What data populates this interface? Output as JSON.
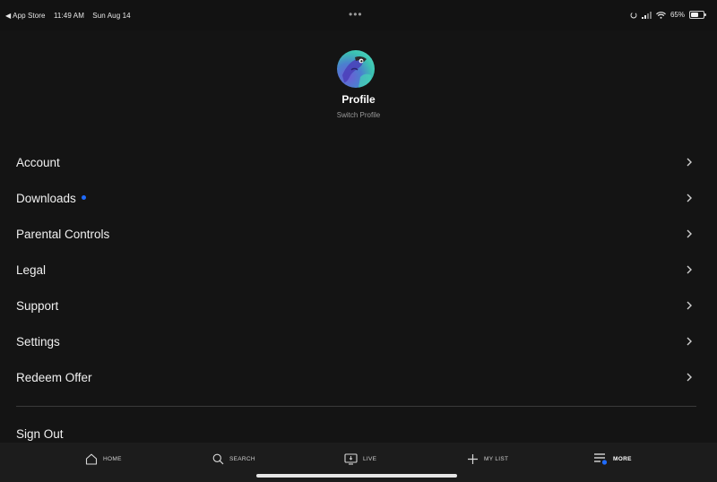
{
  "status_bar": {
    "back_app": "◀ App Store",
    "time": "11:49 AM",
    "date": "Sun Aug 14",
    "dots": "•••",
    "battery_percent": "65%",
    "battery_level": 0.65
  },
  "profile": {
    "name": "Profile",
    "switch_label": "Switch Profile"
  },
  "menu": {
    "items": [
      {
        "label": "Account"
      },
      {
        "label": "Downloads",
        "has_badge": true
      },
      {
        "label": "Parental Controls"
      },
      {
        "label": "Legal"
      },
      {
        "label": "Support"
      },
      {
        "label": "Settings"
      },
      {
        "label": "Redeem Offer"
      }
    ],
    "sign_out": "Sign Out"
  },
  "tab_bar": {
    "tabs": [
      {
        "label": "HOME",
        "icon": "home-icon"
      },
      {
        "label": "SEARCH",
        "icon": "search-icon"
      },
      {
        "label": "LIVE",
        "icon": "live-tv-icon"
      },
      {
        "label": "MY LIST",
        "icon": "plus-icon"
      },
      {
        "label": "MORE",
        "icon": "more-menu-icon",
        "active": true
      }
    ]
  },
  "colors": {
    "background": "#141414",
    "accent": "#1f6bff",
    "text": "#f0f0f0",
    "muted": "#9a9a9a"
  }
}
